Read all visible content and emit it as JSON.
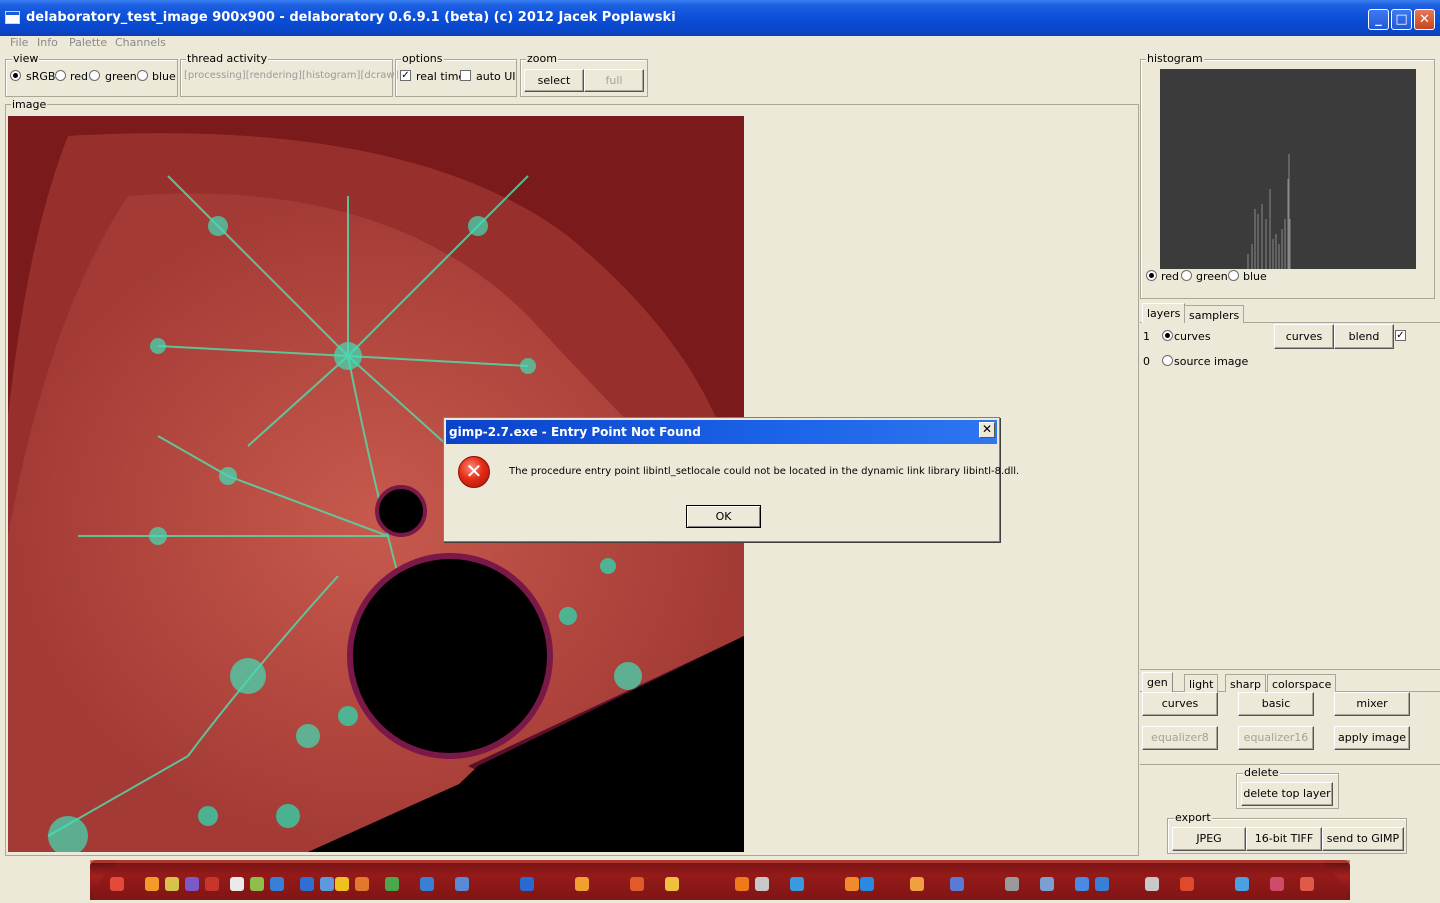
{
  "window": {
    "title": "delaboratory_test_image 900x900 - delaboratory 0.6.9.1 (beta) (c) 2012 Jacek Poplawski",
    "minimize": "_",
    "maximize": "□",
    "close": "✕"
  },
  "menu": [
    "File",
    "Info",
    "Palette",
    "Channels"
  ],
  "view": {
    "label": "view",
    "options": [
      "sRGB",
      "red",
      "green",
      "blue"
    ],
    "selected": "sRGB"
  },
  "thread_activity": {
    "label": "thread activity",
    "text": "[processing][rendering][histogram][dcraw]"
  },
  "options": {
    "label": "options",
    "real_time": "real time",
    "real_time_checked": true,
    "auto_ui": "auto UI",
    "auto_ui_checked": false
  },
  "zoom": {
    "label": "zoom",
    "select": "select",
    "full": "full"
  },
  "image": {
    "label": "image"
  },
  "histogram": {
    "label": "histogram",
    "channels": [
      "red",
      "green",
      "blue"
    ],
    "selected": "red"
  },
  "layers_tabs": [
    "layers",
    "samplers"
  ],
  "layers": [
    {
      "index": "1",
      "name": "curves",
      "selected": true,
      "button1": "curves",
      "button2": "blend",
      "enabled": true
    },
    {
      "index": "0",
      "name": "source image",
      "selected": false
    }
  ],
  "action_tabs": [
    "gen",
    "light",
    "sharp",
    "colorspace"
  ],
  "actions": {
    "curves": "curves",
    "basic": "basic",
    "mixer": "mixer",
    "equalizer8": "equalizer8",
    "equalizer16": "equalizer16",
    "apply_image": "apply image"
  },
  "delete": {
    "label": "delete",
    "button": "delete top layer"
  },
  "export": {
    "label": "export",
    "jpeg": "JPEG",
    "tiff": "16-bit TIFF",
    "gimp": "send to GIMP"
  },
  "dialog": {
    "title": "gimp-2.7.exe - Entry Point Not Found",
    "message": "The procedure entry point libintl_setlocale could not be located in the dynamic link library libintl-8.dll.",
    "ok": "OK",
    "close": "✕",
    "icon": "error-icon"
  }
}
